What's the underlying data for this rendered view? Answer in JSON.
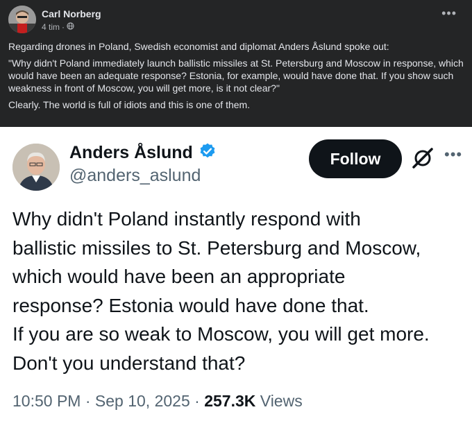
{
  "fb_post": {
    "author": "Carl Norberg",
    "time": "4 tim",
    "separator": "·",
    "privacy_icon": "globe-icon",
    "more_icon": "more-horizontal-icon",
    "more_glyph": "•••",
    "paragraphs": [
      "Regarding drones in Poland, Swedish economist and diplomat Anders Åslund spoke out:",
      "\"Why didn't Poland immediately launch ballistic missiles at St. Petersburg and Moscow in response, which would have been an adequate response? Estonia, for example, would have done that. If you show such weakness in front of Moscow, you will get more, is it not clear?\"",
      "Clearly. The world is full of idiots and this is one of them."
    ]
  },
  "tweet": {
    "author_name": "Anders Åslund",
    "handle": "@anders_aslund",
    "verified_icon": "verified-badge-icon",
    "follow_label": "Follow",
    "grok_icon": "grok-icon",
    "more_glyph": "•••",
    "body_lines": [
      "Why didn't Poland instantly respond with",
      "ballistic missiles to St. Petersburg and Moscow,",
      "which would have been an appropriate",
      "response? Estonia would have done that.",
      "If you are so weak to Moscow, you will get more.",
      "Don't you understand that?"
    ],
    "time": "10:50 PM",
    "date": "Sep 10, 2025",
    "sep": "·",
    "views_count": "257.3K",
    "views_label": "Views"
  },
  "colors": {
    "fb_background": "#242526",
    "fb_text": "#e4e6eb",
    "fb_secondary": "#b0b3b8",
    "tweet_background": "#ffffff",
    "tweet_text": "#0f1419",
    "tweet_secondary": "#536471",
    "verified_blue": "#1d9bf0"
  }
}
